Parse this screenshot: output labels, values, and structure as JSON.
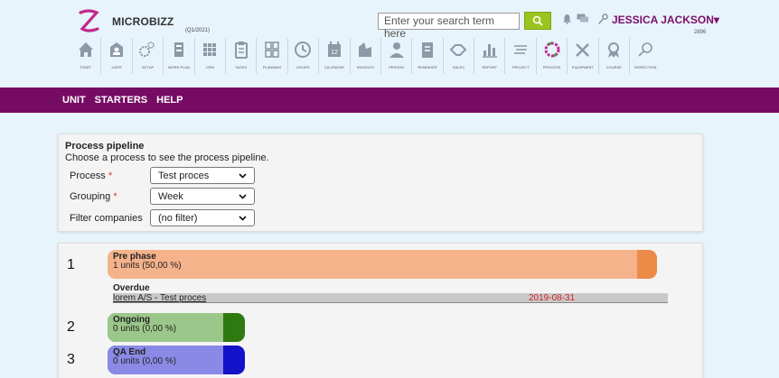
{
  "header": {
    "brand": "MICROBIZZ",
    "period": "(Q1/2021)",
    "search_placeholder": "Enter your search term here",
    "user_name": "JESSICA JACKSON▾",
    "user_number": "2896"
  },
  "toolbar": [
    {
      "label": "START",
      "icon": "home-icon"
    },
    {
      "label": "USER",
      "icon": "user-card-icon"
    },
    {
      "label": "SETUP",
      "icon": "gears-icon"
    },
    {
      "label": "WORK PLAN",
      "icon": "workplan-icon"
    },
    {
      "label": "CRM",
      "icon": "grid-icon"
    },
    {
      "label": "TASKS",
      "icon": "clipboard-icon"
    },
    {
      "label": "PLANNING",
      "icon": "planning-icon"
    },
    {
      "label": "HOURS",
      "icon": "clock-icon"
    },
    {
      "label": "CALENDAR",
      "icon": "calendar-icon"
    },
    {
      "label": "INVOICES",
      "icon": "invoice-icon"
    },
    {
      "label": "PERSON",
      "icon": "person-icon"
    },
    {
      "label": "REMINDER",
      "icon": "reminder-icon"
    },
    {
      "label": "SALES",
      "icon": "handshake-icon"
    },
    {
      "label": "REPORT",
      "icon": "bar-chart-icon"
    },
    {
      "label": "PROJECT",
      "icon": "project-icon"
    },
    {
      "label": "PROCESS",
      "icon": "process-icon"
    },
    {
      "label": "EQUIPMENT",
      "icon": "tools-icon"
    },
    {
      "label": "COURSE",
      "icon": "award-icon"
    },
    {
      "label": "INSPECTION",
      "icon": "magnifier-icon"
    }
  ],
  "calendar_day": "12",
  "nav": [
    "UNIT",
    "STARTERS",
    "HELP"
  ],
  "filters": {
    "title": "Process pipeline",
    "description": "Choose a process to see the process pipeline.",
    "rows": [
      {
        "label": "Process",
        "required": "*",
        "value": "Test proces"
      },
      {
        "label": "Grouping",
        "required": "*",
        "value": "Week"
      },
      {
        "label": "Filter companies",
        "required": "",
        "value": "(no filter)"
      }
    ]
  },
  "pipeline": {
    "stages": [
      {
        "num": "1",
        "title": "Pre phase",
        "sub": "1 units (50,00 %)",
        "fill": "#f5b38c",
        "edge": "#ee8a48"
      },
      {
        "num": "2",
        "title": "Ongoing",
        "sub": "0 units (0,00 %)",
        "fill": "#9bc88a",
        "edge": "#2e7a10"
      },
      {
        "num": "3",
        "title": "QA End",
        "sub": "0 units (0,00 %)",
        "fill": "#8a8ae6",
        "edge": "#1212c8"
      }
    ],
    "overdue_title": "Overdue",
    "overdue_item": "lorem A/S - Test proces",
    "overdue_date": "2019-08-31"
  }
}
